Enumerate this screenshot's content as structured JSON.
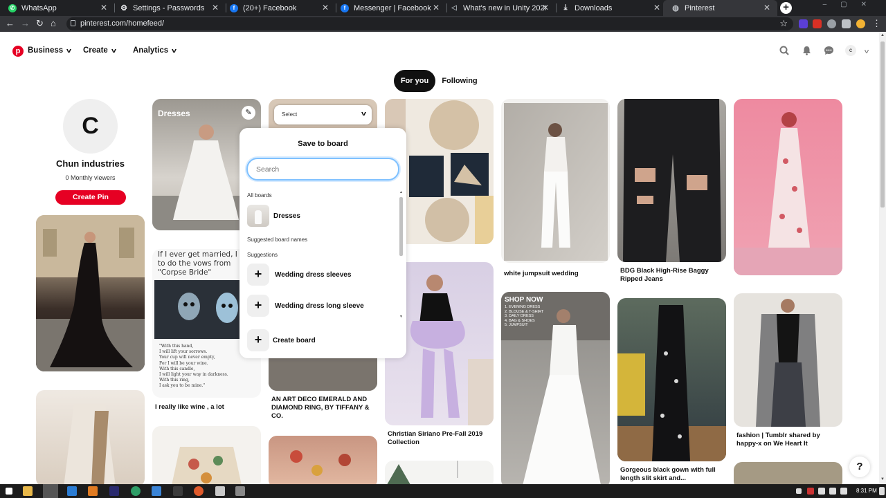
{
  "browser": {
    "tabs": [
      {
        "title": "WhatsApp",
        "icon": "whatsapp-icon",
        "color": "#25d366"
      },
      {
        "title": "Settings - Passwords",
        "icon": "gear-icon",
        "color": "#9aa0a6"
      },
      {
        "title": "(20+) Facebook",
        "icon": "facebook-icon",
        "color": "#1877f2"
      },
      {
        "title": "Messenger | Facebook",
        "icon": "facebook-icon",
        "color": "#1877f2"
      },
      {
        "title": "What's new in Unity 2020.2.1 - U",
        "icon": "unity-icon",
        "color": "#9aa0a6"
      },
      {
        "title": "Downloads",
        "icon": "download-icon",
        "color": "#e8eaed"
      },
      {
        "title": "Pinterest",
        "icon": "globe-icon",
        "color": "#9aa0a6"
      }
    ],
    "url": "pinterest.com/homefeed/"
  },
  "header": {
    "business": "Business",
    "create": "Create",
    "analytics": "Analytics",
    "avatar_letter": "c"
  },
  "feed_toggle": {
    "for_you": "For you",
    "following": "Following"
  },
  "profile": {
    "initial": "C",
    "name": "Chun industries",
    "viewers": "0 Monthly viewers",
    "create_pin": "Create Pin"
  },
  "pins": {
    "dresses_board_title": "Dresses",
    "select_label": "Select",
    "corpse_bride_text": "If I ever get married, I want to do the vows from \"Corpse Bride\"",
    "corpse_bride_poem": "\"With this hand,\nI will lift your sorrows.\nYour cup will never empty,\nFor I will be your wine.\nWith this candle,\nI will light your way in darkness.\nWith this ring,\nI ask you to be mine.\"",
    "shop_now": "SHOP NOW",
    "shop_list": "1. EVENING DRESS\n2. BLOUSE & T-SHIRT\n3. DAILY DRESS\n4. BAG & SHOES\n5. JUMPSUIT",
    "captions": {
      "wine": "I really like wine , a lot",
      "ring": "AN ART DECO EMERALD AND DIAMOND RING, BY TIFFANY & CO.",
      "siriano": "Christian Siriano Pre-Fall 2019 Collection",
      "jumpsuit": "white jumpsuit wedding",
      "jeans": "BDG Black High-Rise Baggy Ripped Jeans",
      "gown": "Gorgeous black gown with full length slit skirt and...",
      "fashion": "fashion | Tumblr shared by happy-x on We Heart It"
    }
  },
  "save_popover": {
    "title": "Save to board",
    "search_placeholder": "Search",
    "all_boards": "All boards",
    "board_name": "Dresses",
    "suggested_board_names": "Suggested board names",
    "suggestions_label": "Suggestions",
    "suggestions": [
      "Wedding dress sleeves",
      "Wedding dress long sleeve"
    ],
    "create_board": "Create board"
  },
  "help_label": "?",
  "taskbar": {
    "time": "8:31 PM"
  },
  "colors": {
    "pinterest_red": "#e60023",
    "chrome_dark": "#202124",
    "focus_blue": "#7fc1ff"
  }
}
